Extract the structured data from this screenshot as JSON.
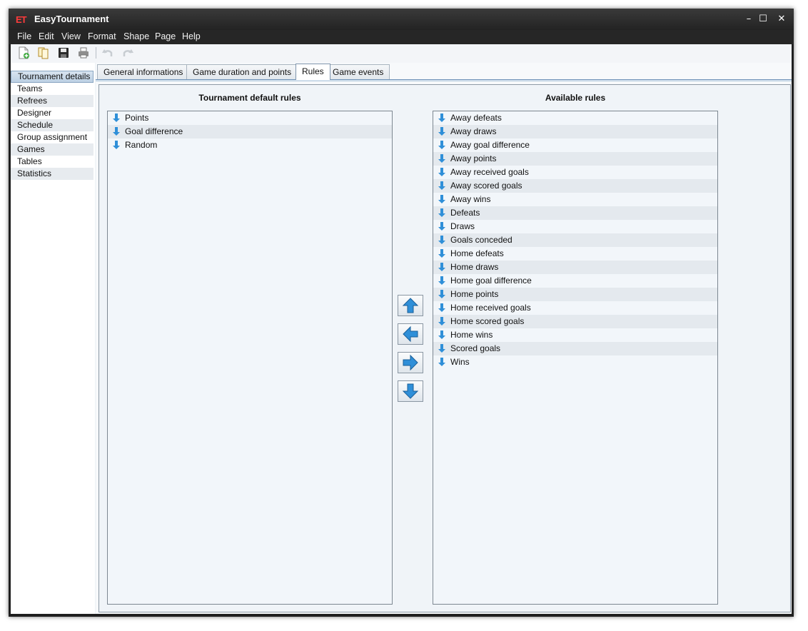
{
  "window": {
    "app_icon_text": "ET",
    "title": "EasyTournament",
    "controls": {
      "minimize": "–",
      "maximize": "☐",
      "close": "✕"
    }
  },
  "menu": [
    "File",
    "Edit",
    "View",
    "Format",
    "Shape",
    "Page",
    "Help"
  ],
  "toolbar": {
    "buttons": [
      "new-document-icon",
      "open-documents-icon",
      "save-icon",
      "print-icon",
      "undo-icon",
      "redo-icon"
    ]
  },
  "sidebar": {
    "items": [
      "Tournament details",
      "Teams",
      "Refrees",
      "Designer",
      "Schedule",
      "Group assignment",
      "Games",
      "Tables",
      "Statistics"
    ],
    "selected": "Tournament details"
  },
  "tabs": {
    "items": [
      "General informations",
      "Game duration and points",
      "Rules",
      "Game events"
    ],
    "active": "Rules"
  },
  "rules": {
    "default_header": "Tournament default rules",
    "available_header": "Available rules",
    "default_rules": [
      "Points",
      "Goal difference",
      "Random"
    ],
    "available_rules": [
      "Away defeats",
      "Away draws",
      "Away goal difference",
      "Away points",
      "Away received goals",
      "Away scored goals",
      "Away wins",
      "Defeats",
      "Draws",
      "Goals conceded",
      "Home defeats",
      "Home draws",
      "Home goal difference",
      "Home points",
      "Home received goals",
      "Home scored goals",
      "Home wins",
      "Scored goals",
      "Wins"
    ]
  },
  "colors": {
    "accent_arrow": "#2f8fd8",
    "title_bar": "#2a2a2a",
    "selection": "#c6d7e8"
  }
}
